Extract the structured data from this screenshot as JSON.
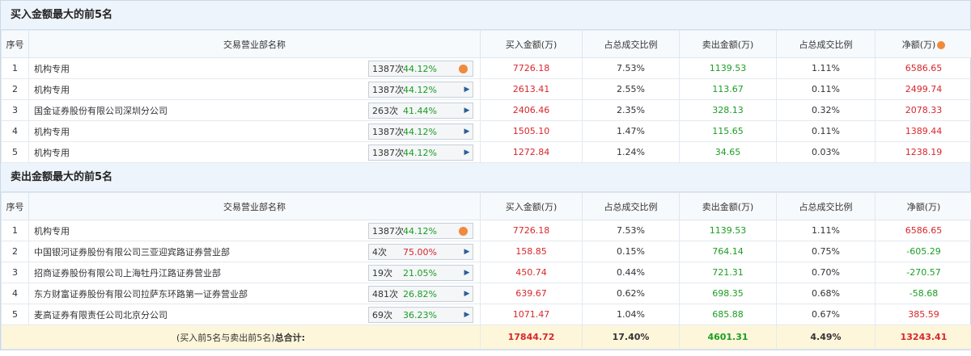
{
  "buy_section": {
    "title": "买入金额最大的前5名",
    "headers": [
      "序号",
      "交易营业部名称",
      "买入金额(万)",
      "占总成交比例",
      "卖出金额(万)",
      "占总成交比例",
      "净额(万)"
    ],
    "rows": [
      {
        "idx": "1",
        "name": "机构专用",
        "count": "1387次",
        "pct": "44.12%",
        "pct_color": "green",
        "icon": "orange-dot-icon",
        "buy": "7726.18",
        "buy_ratio": "7.53%",
        "sell": "1139.53",
        "sell_ratio": "1.11%",
        "net": "6586.65"
      },
      {
        "idx": "2",
        "name": "机构专用",
        "count": "1387次",
        "pct": "44.12%",
        "pct_color": "green",
        "icon": "arrow-right-icon",
        "buy": "2613.41",
        "buy_ratio": "2.55%",
        "sell": "113.67",
        "sell_ratio": "0.11%",
        "net": "2499.74"
      },
      {
        "idx": "3",
        "name": "国金证券股份有限公司深圳分公司",
        "count": "263次",
        "pct": "41.44%",
        "pct_color": "green",
        "icon": "arrow-right-icon",
        "buy": "2406.46",
        "buy_ratio": "2.35%",
        "sell": "328.13",
        "sell_ratio": "0.32%",
        "net": "2078.33"
      },
      {
        "idx": "4",
        "name": "机构专用",
        "count": "1387次",
        "pct": "44.12%",
        "pct_color": "green",
        "icon": "arrow-right-icon",
        "buy": "1505.10",
        "buy_ratio": "1.47%",
        "sell": "115.65",
        "sell_ratio": "0.11%",
        "net": "1389.44"
      },
      {
        "idx": "5",
        "name": "机构专用",
        "count": "1387次",
        "pct": "44.12%",
        "pct_color": "green",
        "icon": "arrow-right-icon",
        "buy": "1272.84",
        "buy_ratio": "1.24%",
        "sell": "34.65",
        "sell_ratio": "0.03%",
        "net": "1238.19"
      }
    ]
  },
  "sell_section": {
    "title": "卖出金额最大的前5名",
    "headers": [
      "序号",
      "交易营业部名称",
      "买入金额(万)",
      "占总成交比例",
      "卖出金额(万)",
      "占总成交比例",
      "净额(万)"
    ],
    "rows": [
      {
        "idx": "1",
        "name": "机构专用",
        "count": "1387次",
        "pct": "44.12%",
        "pct_color": "green",
        "icon": "orange-dot-icon",
        "buy": "7726.18",
        "buy_ratio": "7.53%",
        "sell": "1139.53",
        "sell_ratio": "1.11%",
        "net": "6586.65",
        "net_color": "red"
      },
      {
        "idx": "2",
        "name": "中国银河证券股份有限公司三亚迎宾路证券营业部",
        "count": "4次",
        "pct": "75.00%",
        "pct_color": "red",
        "icon": "arrow-right-icon",
        "buy": "158.85",
        "buy_ratio": "0.15%",
        "sell": "764.14",
        "sell_ratio": "0.75%",
        "net": "-605.29",
        "net_color": "green"
      },
      {
        "idx": "3",
        "name": "招商证券股份有限公司上海牡丹江路证券营业部",
        "count": "19次",
        "pct": "21.05%",
        "pct_color": "green",
        "icon": "arrow-right-icon",
        "buy": "450.74",
        "buy_ratio": "0.44%",
        "sell": "721.31",
        "sell_ratio": "0.70%",
        "net": "-270.57",
        "net_color": "green"
      },
      {
        "idx": "4",
        "name": "东方财富证券股份有限公司拉萨东环路第一证券营业部",
        "count": "481次",
        "pct": "26.82%",
        "pct_color": "green",
        "icon": "arrow-right-icon",
        "buy": "639.67",
        "buy_ratio": "0.62%",
        "sell": "698.35",
        "sell_ratio": "0.68%",
        "net": "-58.68",
        "net_color": "green"
      },
      {
        "idx": "5",
        "name": "麦高证券有限责任公司北京分公司",
        "count": "69次",
        "pct": "36.23%",
        "pct_color": "green",
        "icon": "arrow-right-icon",
        "buy": "1071.47",
        "buy_ratio": "1.04%",
        "sell": "685.88",
        "sell_ratio": "0.67%",
        "net": "385.59",
        "net_color": "red"
      }
    ],
    "total": {
      "label_prefix": "(买入前5名与卖出前5名)",
      "label_bold": "总合计:",
      "buy": "17844.72",
      "buy_ratio": "17.40%",
      "sell": "4601.31",
      "sell_ratio": "4.49%",
      "net": "13243.41"
    }
  },
  "colors": {
    "red": "#d8262b",
    "green": "#1a9d23",
    "header_bg": "#eef4fb",
    "total_bg": "#fdf6da",
    "dot": "#f08a3c"
  }
}
